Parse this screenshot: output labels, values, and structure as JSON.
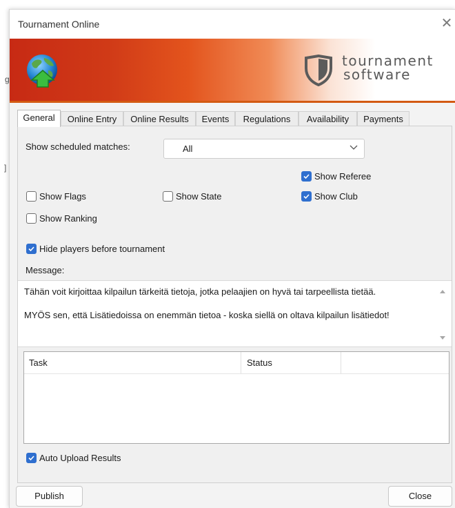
{
  "window": {
    "title": "Tournament Online",
    "close_glyph": "✕"
  },
  "banner": {
    "logo_line1": "tournament",
    "logo_line2": "software",
    "icons": [
      "globe-upload-icon",
      "shield-logo-icon"
    ],
    "colors": {
      "accent": "#d35a12",
      "red": "#c72a14"
    }
  },
  "tabs": [
    {
      "label": "General",
      "active": true
    },
    {
      "label": "Online Entry"
    },
    {
      "label": "Online Results"
    },
    {
      "label": "Events"
    },
    {
      "label": "Regulations"
    },
    {
      "label": "Availability"
    },
    {
      "label": "Payments"
    }
  ],
  "general": {
    "scheduled_label": "Show scheduled matches:",
    "scheduled_value": "All",
    "checkboxes": {
      "show_referee": {
        "label": "Show Referee",
        "checked": true
      },
      "show_flags": {
        "label": "Show Flags",
        "checked": false
      },
      "show_state": {
        "label": "Show State",
        "checked": false
      },
      "show_club": {
        "label": "Show Club",
        "checked": true
      },
      "show_ranking": {
        "label": "Show Ranking",
        "checked": false
      },
      "hide_players": {
        "label": "Hide players before tournament",
        "checked": true
      },
      "auto_upload": {
        "label": "Auto Upload Results",
        "checked": true
      }
    },
    "message_label": "Message:",
    "message_lines": [
      "Tähän voit kirjoittaa kilpailun tärkeitä tietoja, jotka pelaajien on hyvä tai tarpeellista tietää.",
      "MYÖS sen, että Lisätiedoissa on enemmän tietoa - koska siellä on oltava kilpailun lisätiedot!"
    ],
    "tasks_columns": [
      "Task",
      "Status"
    ]
  },
  "buttons": {
    "publish": "Publish",
    "close": "Close"
  }
}
